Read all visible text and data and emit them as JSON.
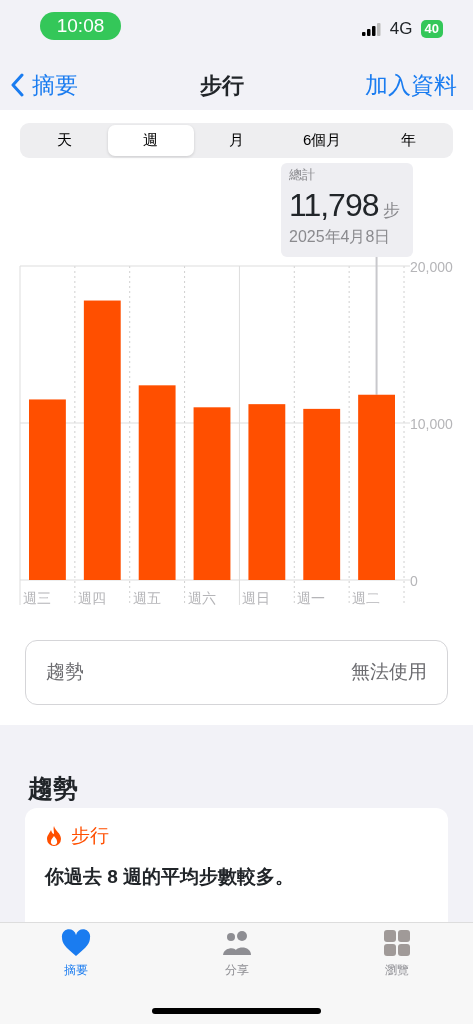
{
  "status_bar": {
    "time": "10:08",
    "network": "4G",
    "battery": "40"
  },
  "nav": {
    "back": "摘要",
    "title": "步行",
    "action": "加入資料"
  },
  "segments": [
    {
      "label": "天",
      "selected": false
    },
    {
      "label": "週",
      "selected": true
    },
    {
      "label": "月",
      "selected": false
    },
    {
      "label": "6個月",
      "selected": false
    },
    {
      "label": "年",
      "selected": false
    }
  ],
  "callout": {
    "label": "總計",
    "value": "11,798",
    "unit": "步",
    "date": "2025年4月8日"
  },
  "chart_data": {
    "type": "bar",
    "categories": [
      "週三",
      "週四",
      "週五",
      "週六",
      "週日",
      "週一",
      "週二"
    ],
    "values": [
      11500,
      17800,
      12400,
      11000,
      11200,
      10900,
      11800
    ],
    "color": "#ff4f00",
    "ylim": [
      0,
      20000
    ],
    "yticks": [
      {
        "value": 0,
        "label": "0"
      },
      {
        "value": 10000,
        "label": "10,000"
      },
      {
        "value": 20000,
        "label": "20,000"
      }
    ],
    "annotations": [
      {
        "x": "週二"
      }
    ]
  },
  "trend_row": {
    "label": "趨勢",
    "value": "無法使用"
  },
  "section_title": "趨勢",
  "trend_card": {
    "category": "步行",
    "text": "你過去 8 週的平均步數較多。"
  },
  "tabs": [
    {
      "label": "摘要",
      "selected": true,
      "kind": "heart"
    },
    {
      "label": "分享",
      "selected": false,
      "kind": "people"
    },
    {
      "label": "瀏覽",
      "selected": false,
      "kind": "grid"
    }
  ]
}
